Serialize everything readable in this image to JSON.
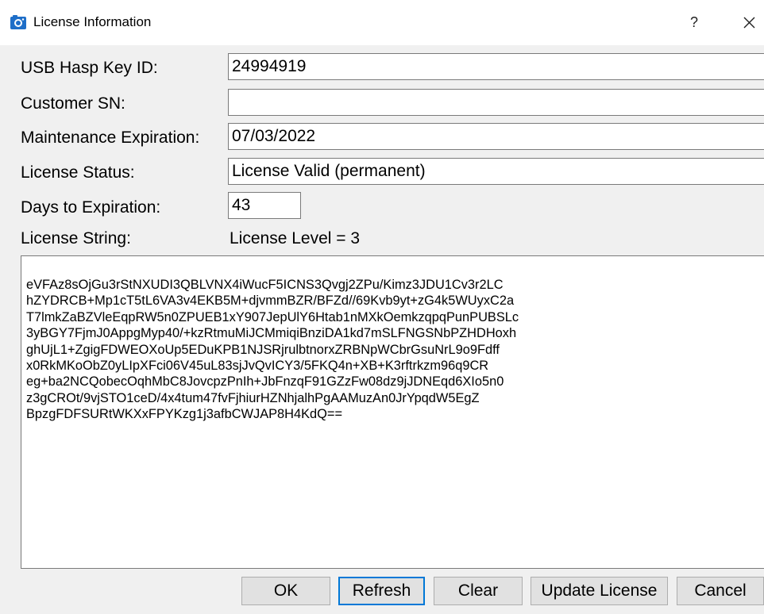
{
  "window": {
    "title": "License Information",
    "help_label": "?",
    "icon": "camera-icon",
    "close_icon": "close-icon"
  },
  "fields": {
    "usb_hasp_key_id": {
      "label": "USB Hasp Key ID:",
      "value": "24994919"
    },
    "customer_sn": {
      "label": "Customer SN:",
      "value": ""
    },
    "maintenance_expiration": {
      "label": "Maintenance Expiration:",
      "value": "07/03/2022"
    },
    "license_status": {
      "label": "License Status:",
      "value": "License Valid (permanent)"
    },
    "days_to_expiration": {
      "label": "Days to Expiration:",
      "value": "43"
    },
    "license_string": {
      "label": "License String:",
      "level": "License Level = 3"
    }
  },
  "license_string_text": "eVFAz8sOjGu3rStNXUDI3QBLVNX4iWucF5ICNS3Qvgj2ZPu/Kimz3JDU1Cv3r2LC\nhZYDRCB+Mp1cT5tL6VA3v4EKB5M+djvmmBZR/BFZd//69Kvb9yt+zG4k5WUyxC2a\nT7lmkZaBZVleEqpRW5n0ZPUEB1xY907JepUlY6Htab1nMXkOemkzqpqPunPUBSLc\n3yBGY7FjmJ0AppgMyp40/+kzRtmuMiJCMmiqiBnziDA1kd7mSLFNGSNbPZHDHoxh\nghUjL1+ZgigFDWEOXoUp5EDuKPB1NJSRjrulbtnorxZRBNpWCbrGsuNrL9o9Fdff\nx0RkMKoObZ0yLIpXFci06V45uL83sjJvQvICY3/5FKQ4n+XB+K3rftrkzm96q9CR\neg+ba2NCQobecOqhMbC8JovcpzPnIh+JbFnzqF91GZzFw08dz9jJDNEqd6XIo5n0\nz3gCROt/9vjSTO1ceD/4x4tum47fvFjhiurHZNhjalhPgAAMuzAn0JrYpqdW5EgZ\nBpzgFDFSURtWKXxFPYKzg1j3afbCWJAP8H4KdQ==",
  "buttons": {
    "ok": "OK",
    "refresh": "Refresh",
    "clear": "Clear",
    "update_license": "Update License",
    "cancel": "Cancel"
  },
  "colors": {
    "icon_blue": "#1e6ec8",
    "default_button_border": "#0078d7"
  }
}
